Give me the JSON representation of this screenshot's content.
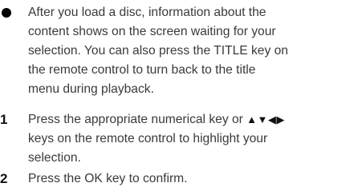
{
  "bullet": {
    "lines": [
      " After you load a disc, information about the",
      "content shows on the screen waiting for your",
      "selection. You can also press the TITLE key on",
      "the remote control to turn back to the title",
      "menu during playback."
    ]
  },
  "steps": [
    {
      "number": "1",
      "line1_text": "Press the appropriate numerical key or ",
      "line1_arrows": "▲▼◀▶",
      "line2": "keys on the remote control to highlight your",
      "line3": "selection."
    },
    {
      "number": "2",
      "line1": "Press the OK key to confirm."
    }
  ]
}
